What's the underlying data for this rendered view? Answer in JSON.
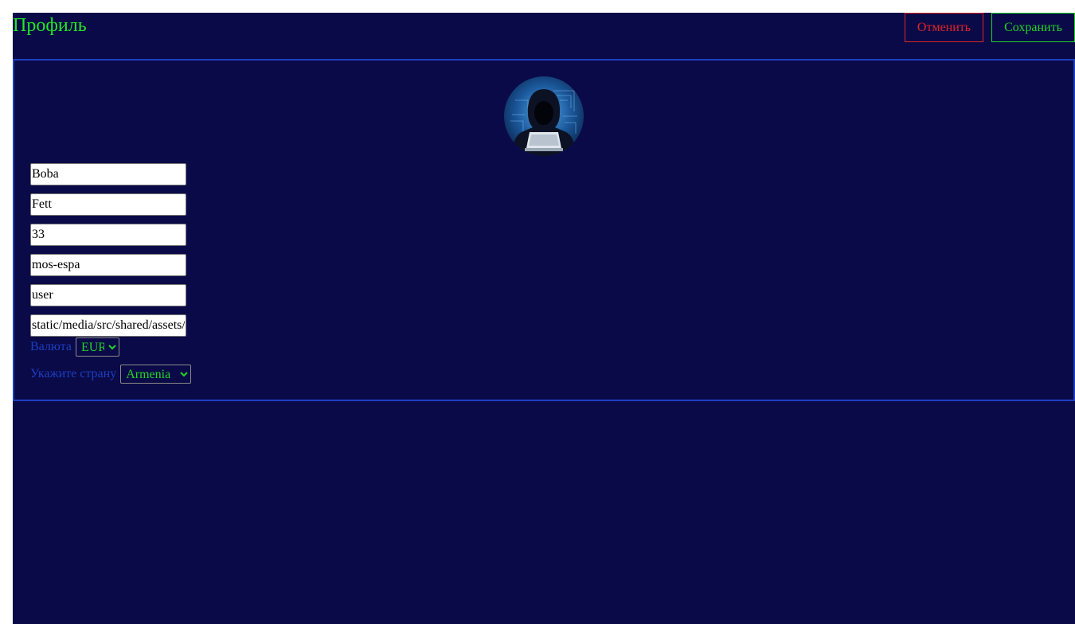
{
  "header": {
    "title": "Профиль",
    "cancel_label": "Отменить",
    "save_label": "Сохранить"
  },
  "profile": {
    "avatar_icon": "hooded-hacker-avatar-icon",
    "fields": [
      {
        "value": "Boba"
      },
      {
        "value": "Fett"
      },
      {
        "value": "33"
      },
      {
        "value": "mos-espa"
      },
      {
        "value": "user"
      },
      {
        "value": "static/media/src/shared/assets/"
      }
    ],
    "currency": {
      "label": "Валюта",
      "selected": "EUR"
    },
    "country": {
      "label": "Укажите страну",
      "selected": "Armenia"
    }
  },
  "colors": {
    "background": "#0a0a48",
    "title": "#22e822",
    "cancel": "#e02424",
    "save": "#22d422",
    "card_border": "#1c3fc2",
    "label": "#1c3fc2"
  }
}
